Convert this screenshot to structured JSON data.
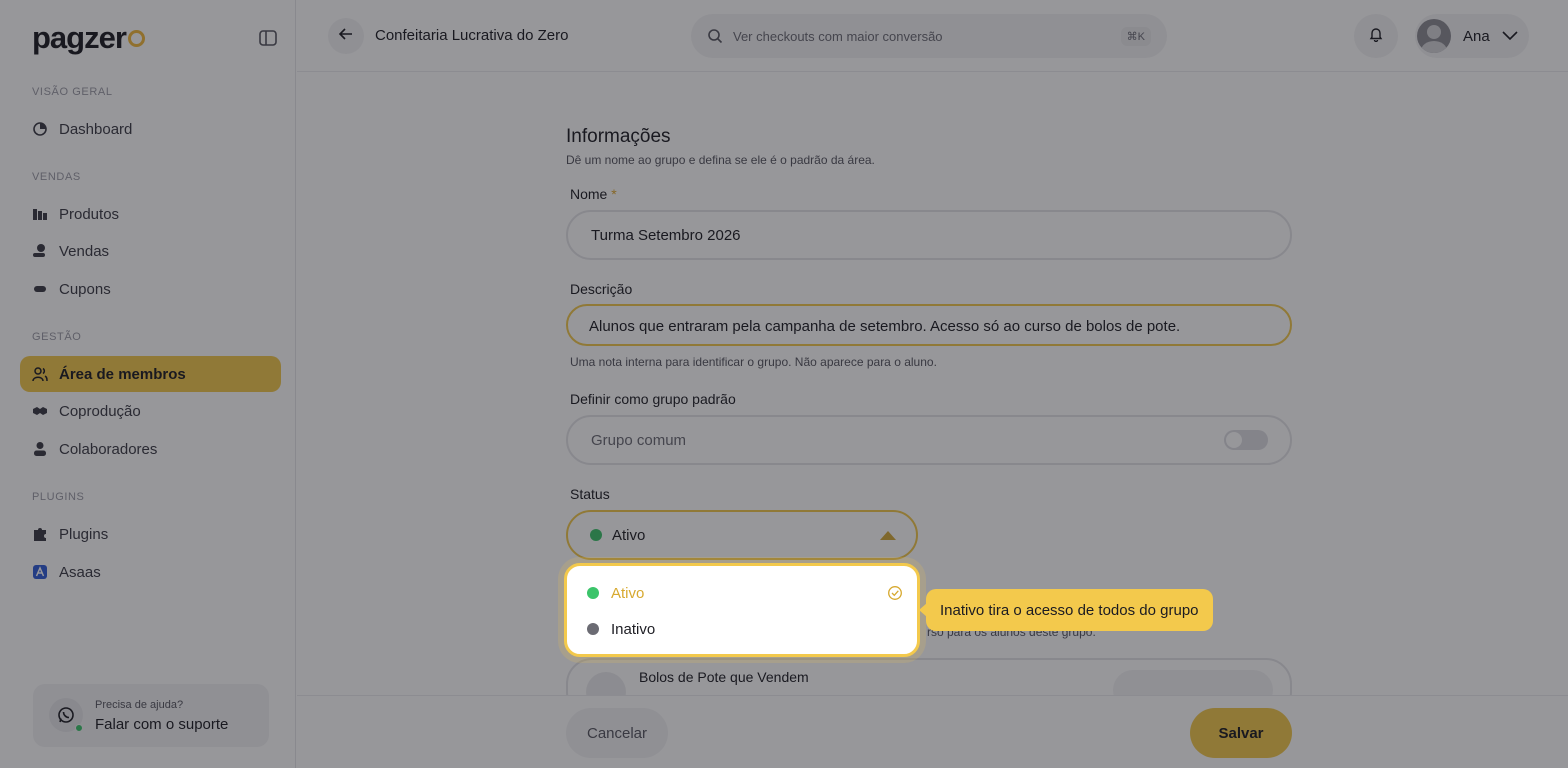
{
  "brand": {
    "logo_text": "pagzer",
    "accent": "#f3c94c"
  },
  "sidebar": {
    "sections": [
      {
        "title": "VISÃO GERAL",
        "items": [
          {
            "label": "Dashboard",
            "icon": "dashboard-icon"
          }
        ]
      },
      {
        "title": "VENDAS",
        "items": [
          {
            "label": "Produtos",
            "icon": "products-icon"
          },
          {
            "label": "Vendas",
            "icon": "sales-icon"
          },
          {
            "label": "Cupons",
            "icon": "coupon-icon"
          }
        ]
      },
      {
        "title": "GESTÃO",
        "items": [
          {
            "label": "Área de membros",
            "icon": "members-icon",
            "active": true
          },
          {
            "label": "Coprodução",
            "icon": "handshake-icon"
          },
          {
            "label": "Colaboradores",
            "icon": "collaborators-icon"
          }
        ]
      },
      {
        "title": "PLUGINS",
        "items": [
          {
            "label": "Plugins",
            "icon": "puzzle-icon"
          },
          {
            "label": "Asaas",
            "icon": "asaas-icon"
          }
        ]
      }
    ],
    "help": {
      "subtitle": "Precisa de ajuda?",
      "link": "Falar com o suporte",
      "icon": "whatsapp-icon"
    }
  },
  "header": {
    "title": "Confeitaria Lucrativa do Zero",
    "search_placeholder": "Ver checkouts com maior conversão",
    "search_shortcut": "⌘K",
    "user_name": "Ana"
  },
  "form": {
    "title": "Informações",
    "subtitle": "Dê um nome ao grupo e defina se ele é o padrão da área.",
    "name_label": "Nome",
    "name_required": "*",
    "name_value": "Turma Setembro 2026",
    "description_label": "Descrição",
    "description_value": "Alunos que entraram pela campanha de setembro. Acesso só ao curso de bolos de pote.",
    "description_hint": "Uma nota interna para identificar o grupo. Não aparece para o aluno.",
    "default_label": "Definir como grupo padrão",
    "default_value": "Grupo comum",
    "default_toggle_on": false,
    "status_label": "Status",
    "status_value": "Ativo",
    "courses_hint": "rso para os alunos deste grupo.",
    "course_name": "Bolos de Pote que Vendem"
  },
  "status_dropdown": {
    "options": [
      {
        "label": "Ativo",
        "color": "#3bc46a",
        "selected": true
      },
      {
        "label": "Inativo",
        "color": "#6b6b73",
        "selected": false
      }
    ]
  },
  "tooltip": {
    "text": "Inativo tira o acesso de todos do grupo"
  },
  "footer": {
    "cancel_label": "Cancelar",
    "save_label": "Salvar"
  }
}
